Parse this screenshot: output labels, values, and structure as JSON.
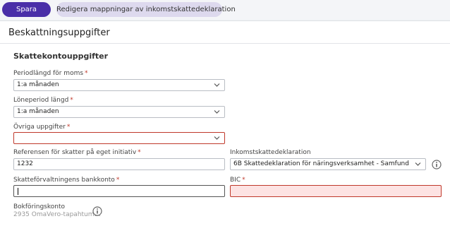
{
  "toolbar": {
    "save_label": "Spara",
    "edit_mapping_label": "Redigera mappningar av inkomstskattedeklaration"
  },
  "page": {
    "title": "Beskattningsuppgifter",
    "section_title": "Skattekontouppgifter"
  },
  "fields": {
    "vat_period": {
      "label": "Periodlängd för moms",
      "value": "1:a månaden"
    },
    "pay_period": {
      "label": "Löneperiod längd",
      "value": "1:a månaden"
    },
    "other_tasks": {
      "label": "Övriga uppgifter",
      "value": ""
    },
    "reference": {
      "label": "Referensen för skatter på eget initiativ",
      "value": "1232"
    },
    "income_tax_declaration": {
      "label": "Inkomstskattedeklaration",
      "value": "6B Skattedeklaration för näringsverksamhet - Samfund"
    },
    "bank_account": {
      "label": "Skatteförvaltningens bankkonto",
      "value": ""
    },
    "bic": {
      "label": "BIC",
      "value": ""
    },
    "booking_account": {
      "label": "Bokföringskonto",
      "value": "2935 OmaVero-tapahtumat"
    }
  },
  "required_marker": "*",
  "colors": {
    "primary": "#4a2fa8",
    "secondary_button": "#ddd9ee",
    "error": "#c0392b",
    "error_fill": "#fde3e3"
  },
  "icons": {
    "select_arrow": "chevron-down-icon",
    "info": "info-icon"
  }
}
